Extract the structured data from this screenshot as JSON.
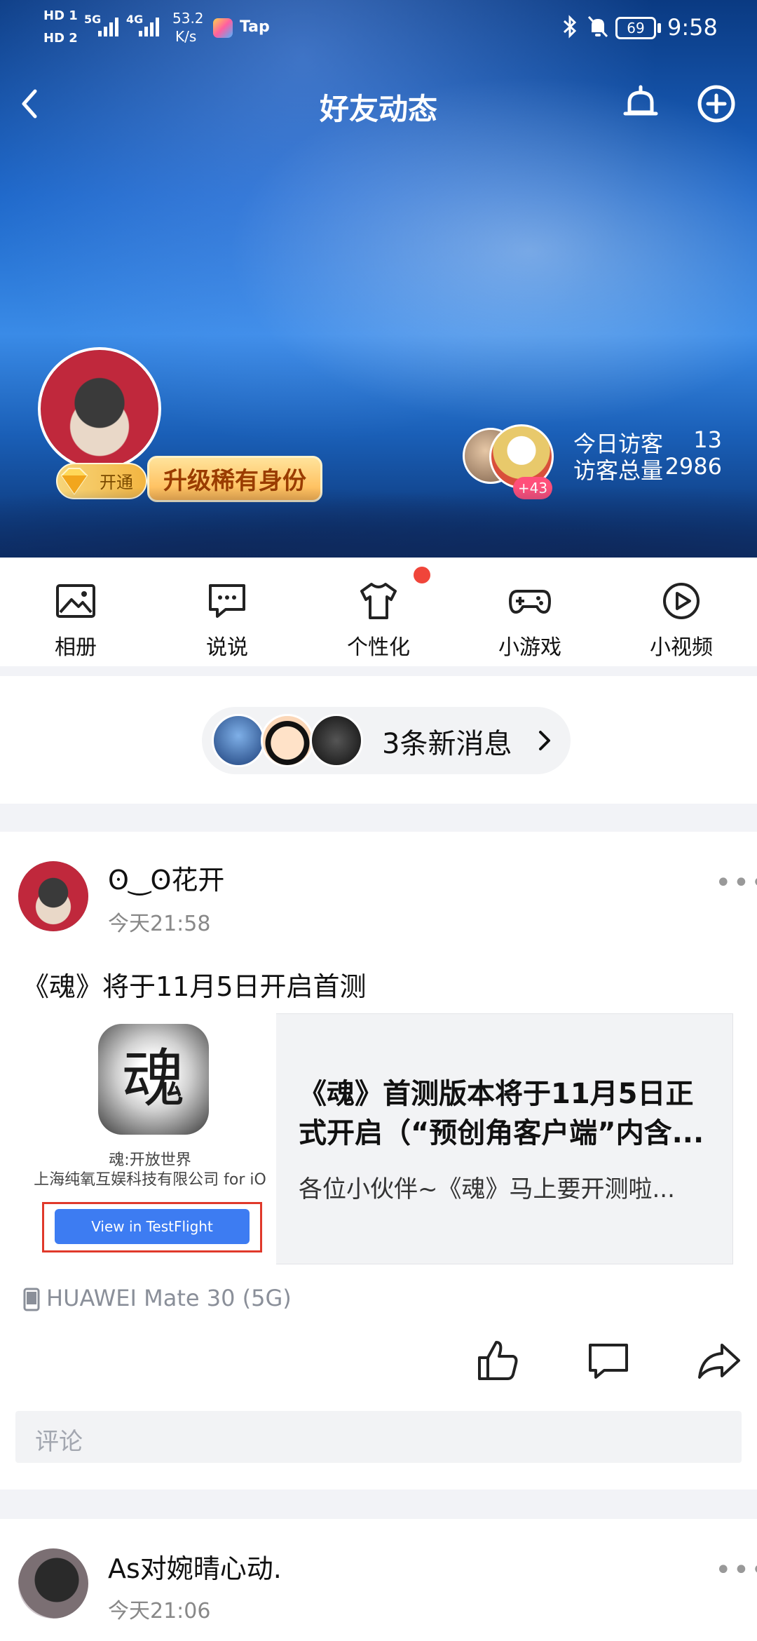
{
  "status_bar": {
    "left_icons": [
      "HD 1",
      "HD 2",
      "5G",
      "4G"
    ],
    "net_speed_value": "53.2",
    "net_speed_unit": "K/s",
    "tap_label": "Tap",
    "battery": "69",
    "time": "9:58"
  },
  "header": {
    "title": "好友动态",
    "back_icon": "chevron-left-icon",
    "bell_icon": "bell-icon",
    "add_icon": "plus-circle-icon",
    "vip_open_label": "开通",
    "upgrade_label": "升级稀有身份",
    "visitor_more_badge": "+43",
    "stats": [
      {
        "label": "今日访客",
        "value": "13"
      },
      {
        "label": "访客总量",
        "value": "2986"
      }
    ]
  },
  "shortcuts": [
    {
      "label": "相册",
      "icon": "image-icon"
    },
    {
      "label": "说说",
      "icon": "chat-bubble-icon"
    },
    {
      "label": "个性化",
      "icon": "tshirt-icon"
    },
    {
      "label": "小游戏",
      "icon": "gamepad-icon"
    },
    {
      "label": "小视频",
      "icon": "play-circle-icon"
    }
  ],
  "new_messages": {
    "label": "3条新消息"
  },
  "posts": [
    {
      "username": "ʘ‿ʘ花开",
      "time": "今天21:58",
      "text": "《魂》将于11月5日开启首测",
      "card": {
        "app_name": "魂:开放世界",
        "company": "上海纯氧互娱科技有限公司 for iO",
        "button": "View in TestFlight",
        "icon_glyph": "魂",
        "title": "《魂》首测版本将于11月5日正式开启（“预创角客户端”内含...",
        "desc": "各位小伙伴~《魂》马上要开测啦..."
      },
      "device": "HUAWEI Mate 30 (5G)",
      "comment_placeholder": "评论"
    },
    {
      "username": "As对婉晴心动.",
      "time": "今天21:06"
    }
  ],
  "colors": {
    "accent_blue": "#3d7cf2",
    "badge_red": "#f0453a",
    "vip_gold": "#f3b541"
  }
}
